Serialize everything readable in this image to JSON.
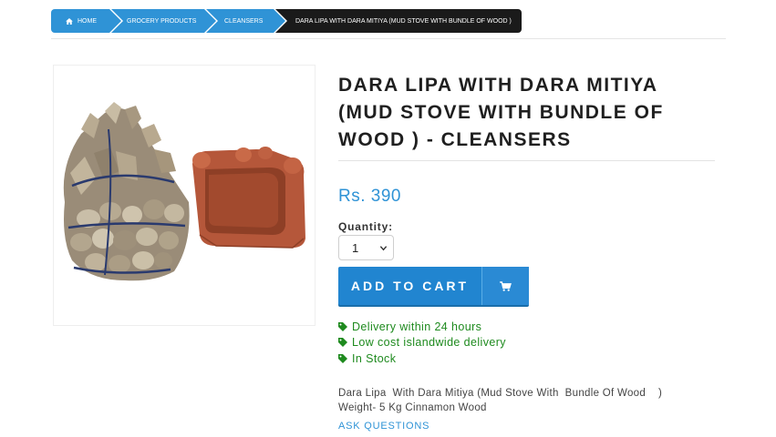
{
  "breadcrumb": {
    "home": "HOME",
    "grocery": "GROCERY PRODUCTS",
    "cleansers": "CLEANSERS",
    "current": "DARA LIPA WITH DARA MITIYA (MUD STOVE WITH BUNDLE OF WOOD )"
  },
  "product": {
    "title": "DARA LIPA WITH DARA MITIYA (MUD STOVE WITH BUNDLE OF WOOD ) - CLEANSERS",
    "price": "Rs. 390",
    "quantity_label": "Quantity:",
    "quantity_value": "1",
    "add_to_cart": "ADD TO CART",
    "features": [
      "Delivery within 24 hours",
      "Low cost islandwide delivery",
      "In Stock"
    ],
    "description_line1": "Dara Lipa  With Dara Mitiya (Mud Stove With  Bundle Of Wood    )",
    "description_line2": "Weight- 5 Kg Cinnamon Wood",
    "ask_questions": "ASK QUESTIONS"
  },
  "colors": {
    "accent": "#2f93d6",
    "button": "#2185d0",
    "feature_green": "#1e8a1e",
    "breadcrumb_active": "#1a1a1a"
  },
  "icons": {
    "home": "home-icon",
    "cart": "shopping-cart-icon",
    "feature": "tag-icon",
    "select": "chevron-down-icon"
  }
}
